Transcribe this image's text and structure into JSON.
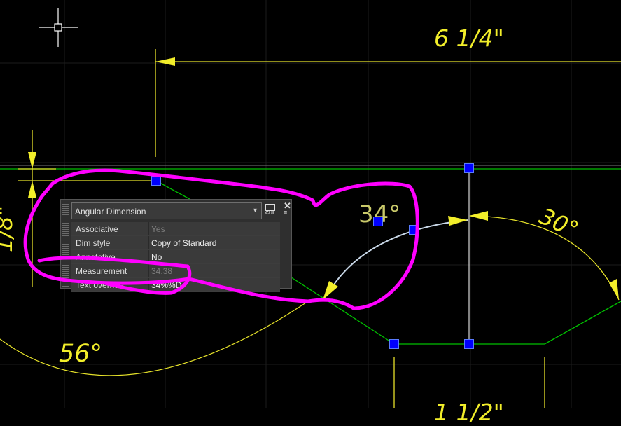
{
  "colors": {
    "canvas": "#000000",
    "dimension": "#f2ee2a",
    "geometry_green": "#00c000",
    "grip": "#0000ff",
    "markup": "#ff00ff",
    "selected_dimension": "#c9d8e8"
  },
  "dimensions": {
    "top_linear": "6 1/4\"",
    "angle_right": "30°",
    "angle_left": "56°",
    "vertical_left": "1/8\"",
    "selected_angle": "34°",
    "bottom_linear": "1 1/2\""
  },
  "properties_palette": {
    "object_type": "Angular Dimension",
    "cui_label": "CUI",
    "close_glyph": "✕",
    "menu_glyph": "≡",
    "rows": [
      {
        "key": "Associative",
        "value": "Yes",
        "disabled": true
      },
      {
        "key": "Dim style",
        "value": "Copy of Standard",
        "disabled": false
      },
      {
        "key": "Annotative",
        "value": "No",
        "disabled": false
      },
      {
        "key": "Measurement",
        "value": "34.38",
        "disabled": true
      },
      {
        "key": "Text override",
        "value": "34%%D",
        "disabled": false
      }
    ]
  },
  "cursor": {
    "icon": "crosshair-icon"
  }
}
